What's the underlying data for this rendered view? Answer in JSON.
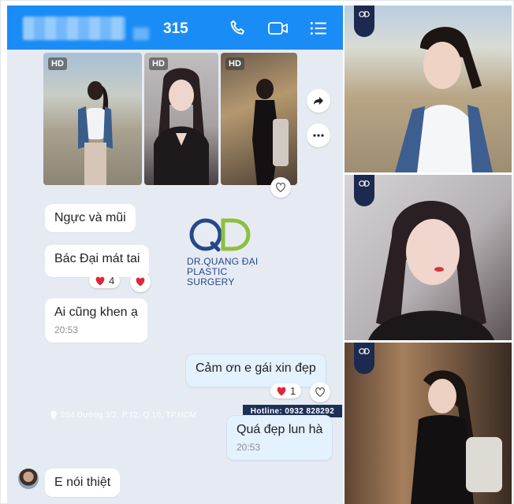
{
  "header": {
    "count": "315",
    "icons": [
      "phone-icon",
      "video-call-icon",
      "menu-icon"
    ]
  },
  "photos": {
    "badges": [
      "HD",
      "HD",
      "HD"
    ]
  },
  "messages": [
    {
      "text": "Ngực và mũi",
      "side": "left"
    },
    {
      "text": "Bác Đại mát tai",
      "side": "left",
      "reaction_count": "4"
    },
    {
      "text": "Ai cũng khen ạ",
      "time": "20:53",
      "side": "left"
    },
    {
      "text": "Cảm ơn e gái xin đẹp",
      "side": "right",
      "reaction_count": "1"
    },
    {
      "text": "Quá đẹp lun hà",
      "time": "20:53",
      "side": "right"
    },
    {
      "text": "E nói thiệt",
      "side": "left"
    }
  ],
  "watermark": {
    "line1": "DR.QUANG ĐẠI",
    "line2": "PLASTIC",
    "line3": "SURGERY",
    "address": "204 Đường 3/2, P.12, Q.10, TP.HCM",
    "hotline": "Hotline: 0932 828292"
  },
  "colors": {
    "header": "#1a8cf5",
    "chat_bg": "#e6ebf3",
    "reaction_heart": "#e0243a",
    "logo_blue": "#24488c",
    "logo_green": "#8dbf3e"
  }
}
